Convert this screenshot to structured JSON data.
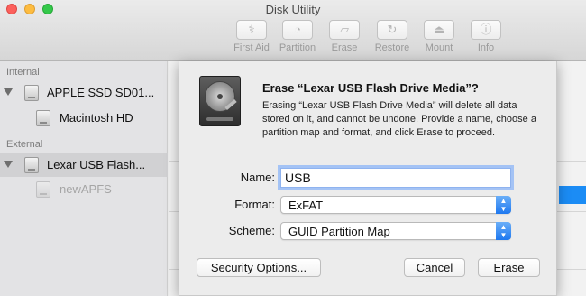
{
  "window": {
    "title": "Disk Utility"
  },
  "toolbar": {
    "items": [
      {
        "label": "First Aid",
        "icon": "stethoscope-icon"
      },
      {
        "label": "Partition",
        "icon": "partition-pie-icon"
      },
      {
        "label": "Erase",
        "icon": "eraser-icon"
      },
      {
        "label": "Restore",
        "icon": "restore-arrow-icon"
      },
      {
        "label": "Mount",
        "icon": "mount-icon"
      },
      {
        "label": "Info",
        "icon": "info-icon"
      }
    ]
  },
  "sidebar": {
    "internal_header": "Internal",
    "external_header": "External",
    "items": [
      {
        "label": "APPLE SSD SD01..."
      },
      {
        "label": "Macintosh HD"
      },
      {
        "label": "Lexar USB Flash..."
      },
      {
        "label": "newAPFS"
      }
    ]
  },
  "dialog": {
    "title": "Erase “Lexar USB Flash Drive Media”?",
    "message": "Erasing “Lexar USB Flash Drive Media” will delete all data stored on it, and cannot be undone. Provide a name, choose a partition map and format, and click Erase to proceed.",
    "name_label": "Name:",
    "name_value": "USB",
    "format_label": "Format:",
    "format_value": "ExFAT",
    "scheme_label": "Scheme:",
    "scheme_value": "GUID Partition Map",
    "security_button": "Security Options...",
    "cancel_button": "Cancel",
    "erase_button": "Erase"
  },
  "colors": {
    "accent": "#1e78f0",
    "selection": "#d1d1d3",
    "close": "#fc605c",
    "minimize": "#fdbc40",
    "zoom": "#34c84a"
  }
}
